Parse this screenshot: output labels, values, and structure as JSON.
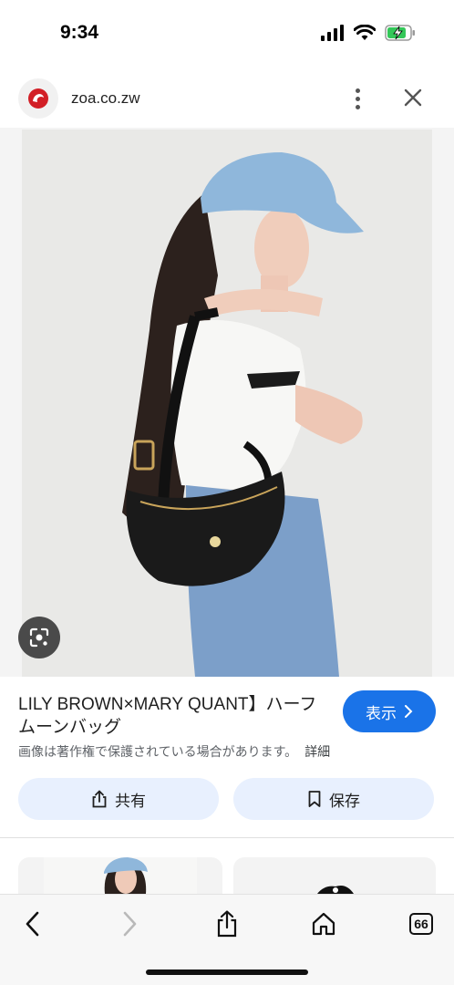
{
  "status_bar": {
    "time": "9:34"
  },
  "url_bar": {
    "domain": "zoa.co.zw",
    "menu_icon": "more-vert-icon",
    "close_icon": "close-icon"
  },
  "result": {
    "title": "LILY BROWN×MARY QUANT】ハーフムーンバッグ",
    "show_button_label": "表示",
    "copyright_notice": "画像は著作権で保護されている場合があります。",
    "details_link": "詳細",
    "share_label": "共有",
    "save_label": "保存"
  },
  "bottom_toolbar": {
    "tab_count": "66"
  },
  "colors": {
    "accent": "#1a73e8",
    "chip_bg": "#e8f0fe",
    "battery": "#34c759"
  }
}
